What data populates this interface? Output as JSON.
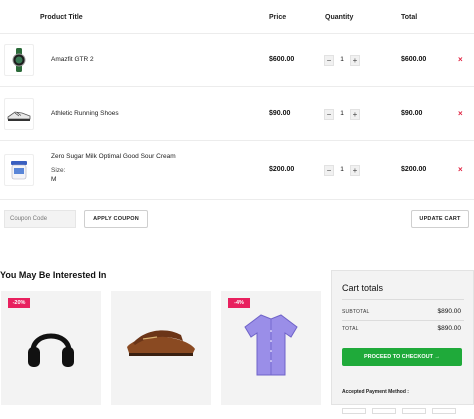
{
  "table": {
    "headers": {
      "product": "Product Title",
      "price": "Price",
      "quantity": "Quantity",
      "total": "Total"
    },
    "rows": [
      {
        "name": "Amazfit GTR 2",
        "price": "$600.00",
        "qty": "1",
        "total": "$600.00",
        "icon": "smartwatch-icon"
      },
      {
        "name": "Athletic Running Shoes",
        "price": "$90.00",
        "qty": "1",
        "total": "$90.00",
        "icon": "shoe-icon"
      },
      {
        "name": "Zero Sugar Milk Optimal Good Sour Cream",
        "size_label": "Size:",
        "size_value": "M",
        "price": "$200.00",
        "qty": "1",
        "total": "$200.00",
        "icon": "cream-jar-icon"
      }
    ],
    "minus": "−",
    "plus": "+",
    "remove": "×"
  },
  "coupon": {
    "placeholder": "Coupon Code",
    "apply_label": "APPLY COUPON",
    "update_label": "UPDATE CART"
  },
  "related": {
    "title": "You May Be Interested In",
    "items": [
      {
        "badge": "-20%",
        "icon": "headphones-icon"
      },
      {
        "badge": "",
        "icon": "loafer-shoe-icon"
      },
      {
        "badge": "-4%",
        "icon": "shirt-icon"
      }
    ]
  },
  "totals": {
    "title": "Cart totals",
    "subtotal_label": "SUBTOTAL",
    "subtotal_value": "$890.00",
    "total_label": "TOTAL",
    "total_value": "$890.00",
    "checkout_label": "PROCEED TO CHECKOUT →",
    "payment_label": "Accepted Payment Method :"
  },
  "colors": {
    "accent_green": "#1faa3a",
    "badge_pink": "#e8205e",
    "remove_red": "#e0203f"
  }
}
